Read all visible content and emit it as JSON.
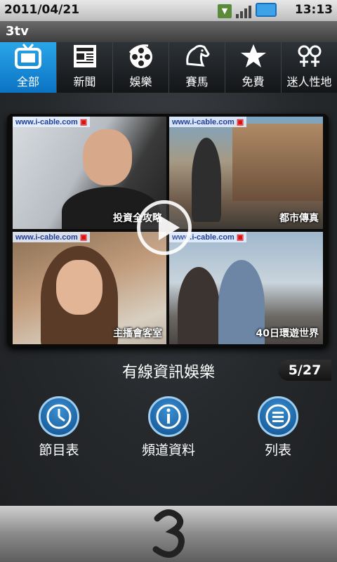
{
  "status": {
    "date": "2011/04/21",
    "time": "13:13",
    "notification_icon": "notification-icon"
  },
  "app": {
    "title": "3tv"
  },
  "tabs": [
    {
      "label": "全部",
      "icon": "tv-icon",
      "active": true
    },
    {
      "label": "新聞",
      "icon": "newspaper-icon",
      "active": false
    },
    {
      "label": "娛樂",
      "icon": "film-reel-icon",
      "active": false
    },
    {
      "label": "賽馬",
      "icon": "horse-icon",
      "active": false
    },
    {
      "label": "免費",
      "icon": "star-icon",
      "active": false
    },
    {
      "label": "迷人性地",
      "icon": "gender-icon",
      "active": false
    }
  ],
  "preview": {
    "watermark": "www.i-cable.com",
    "captions": [
      "投資全攻略",
      "都市傳真",
      "主播會客室",
      "40日環遊世界"
    ]
  },
  "channel": {
    "name": "有線資訊娛樂",
    "position": "5/27"
  },
  "actions": [
    {
      "label": "節目表",
      "icon": "clock-icon"
    },
    {
      "label": "頻道資料",
      "icon": "info-icon"
    },
    {
      "label": "列表",
      "icon": "list-icon"
    }
  ],
  "colors": {
    "accent": "#1a8fdb",
    "background": "#26292c"
  }
}
